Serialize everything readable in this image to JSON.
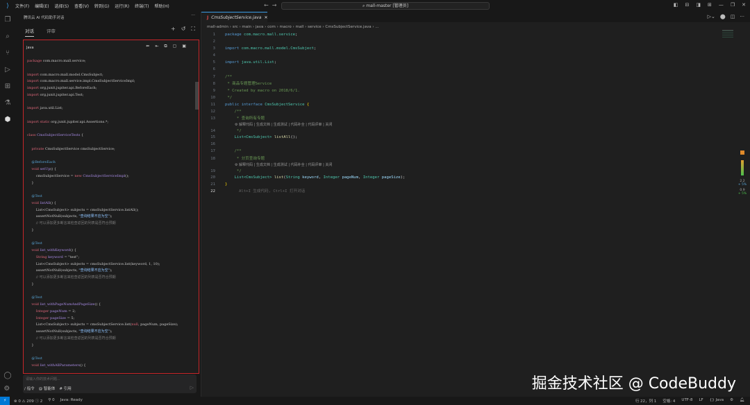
{
  "titlebar": {
    "menu": [
      "文件(F)",
      "编辑(E)",
      "选择(S)",
      "查看(V)",
      "转到(G)",
      "运行(R)",
      "终端(T)",
      "帮助(H)"
    ],
    "search": "mall-master [管理员]"
  },
  "sidebar": {
    "title": "腾讯云 AI 代码助手对话",
    "tabs": [
      "对话",
      "评审"
    ],
    "code_block": {
      "language": "Java",
      "lines": [
        [
          [
            "k",
            "package"
          ],
          [
            "p",
            " com.macro.mall.service;"
          ]
        ],
        [],
        [
          [
            "k",
            "import"
          ],
          [
            "p",
            " com.macro.mall.model.CmsSubject;"
          ]
        ],
        [
          [
            "k",
            "import"
          ],
          [
            "p",
            " com.macro.mall.service.impl.CmsSubjectServiceImpl;"
          ]
        ],
        [
          [
            "k",
            "import"
          ],
          [
            "p",
            " org.junit.jupiter.api.BeforeEach;"
          ]
        ],
        [
          [
            "k",
            "import"
          ],
          [
            "p",
            " org.junit.jupiter.api.Test;"
          ]
        ],
        [],
        [
          [
            "k",
            "import"
          ],
          [
            "p",
            " java.util.List;"
          ]
        ],
        [],
        [
          [
            "k",
            "import static"
          ],
          [
            "p",
            " org.junit.jupiter.api.Assertions.*;"
          ]
        ],
        [],
        [
          [
            "k",
            "class"
          ],
          [
            "ty",
            " CmsSubjectServiceTests"
          ],
          [
            "p",
            " {"
          ]
        ],
        [],
        [
          [
            "k",
            "    private"
          ],
          [
            "p",
            " CmsSubjectService cmsSubjectService;"
          ]
        ],
        [],
        [
          [
            "an",
            "    @BeforeEach"
          ]
        ],
        [
          [
            "k",
            "    void"
          ],
          [
            "ty",
            " setUp"
          ],
          [
            "p",
            "() {"
          ]
        ],
        [
          [
            "p",
            "        cmsSubjectService = "
          ],
          [
            "k",
            "new"
          ],
          [
            "ty",
            " CmsSubjectServiceImpl"
          ],
          [
            "p",
            "();"
          ]
        ],
        [
          [
            "p",
            "    }"
          ]
        ],
        [],
        [
          [
            "an",
            "    @Test"
          ]
        ],
        [
          [
            "k",
            "    void"
          ],
          [
            "ty",
            " listAll"
          ],
          [
            "p",
            "() {"
          ]
        ],
        [
          [
            "p",
            "        List<CmsSubject> subjects = cmsSubjectService.listAll();"
          ]
        ],
        [
          [
            "p",
            "        assertNotNull(subjects, "
          ],
          [
            "st",
            "\"查询结果不应为空\""
          ],
          [
            "p",
            ");"
          ]
        ],
        [
          [
            "cm",
            "        // 可以添加更多断言来检查返回的列表是否符合预期"
          ]
        ],
        [
          [
            "p",
            "    }"
          ]
        ],
        [],
        [
          [
            "an",
            "    @Test"
          ]
        ],
        [
          [
            "k",
            "    void"
          ],
          [
            "ty",
            " list_withKeyword"
          ],
          [
            "p",
            "() {"
          ]
        ],
        [
          [
            "k",
            "        String"
          ],
          [
            "ty",
            " keyword"
          ],
          [
            "p",
            " = \"test\";"
          ]
        ],
        [
          [
            "p",
            "        List<CmsSubject> subjects = cmsSubjectService.list(keyword, 1, 10);"
          ]
        ],
        [
          [
            "p",
            "        assertNotNull(subjects, "
          ],
          [
            "st",
            "\"查询结果不应为空\""
          ],
          [
            "p",
            ");"
          ]
        ],
        [
          [
            "cm",
            "        // 可以添加更多断言来检查返回的列表是否符合预期"
          ]
        ],
        [
          [
            "p",
            "    }"
          ]
        ],
        [],
        [
          [
            "an",
            "    @Test"
          ]
        ],
        [
          [
            "k",
            "    void"
          ],
          [
            "ty",
            " list_withPageNumAndPageSize"
          ],
          [
            "p",
            "() {"
          ]
        ],
        [
          [
            "k",
            "        Integer"
          ],
          [
            "ty",
            " pageNum"
          ],
          [
            "p",
            " = 2;"
          ]
        ],
        [
          [
            "k",
            "        Integer"
          ],
          [
            "ty",
            " pageSize"
          ],
          [
            "p",
            " = 5;"
          ]
        ],
        [
          [
            "p",
            "        List<CmsSubject> subjects = cmsSubjectService.list("
          ],
          [
            "k",
            "null"
          ],
          [
            "p",
            ", pageNum, pageSize);"
          ]
        ],
        [
          [
            "p",
            "        assertNotNull(subjects, "
          ],
          [
            "st",
            "\"查询结果不应为空\""
          ],
          [
            "p",
            ");"
          ]
        ],
        [
          [
            "cm",
            "        // 可以添加更多断言来检查返回的列表是否符合预期"
          ]
        ],
        [
          [
            "p",
            "    }"
          ]
        ],
        [],
        [
          [
            "an",
            "    @Test"
          ]
        ],
        [
          [
            "k",
            "    void"
          ],
          [
            "ty",
            " list_withAllParameters"
          ],
          [
            "p",
            "() {"
          ]
        ]
      ]
    },
    "input": {
      "placeholder": "请输入你的技术问题...",
      "options": [
        "/ 指令",
        "@ 智能体",
        "# 引用"
      ]
    }
  },
  "editor": {
    "tab": "CmsSubjectService.java",
    "breadcrumb": "mall-admin › src › main › java › com › macro › mall › service › CmsSubjectService.java › ...",
    "codelens": "⚙ 解释代码 | 生成文档 | 生成测试 | 代码补全 | 代码评审 | 关闭",
    "hint": "Alt+I 生成代码, Ctrl+I 打开对话",
    "lines": [
      {
        "n": "1",
        "t": [
          [
            "ekw",
            "package"
          ],
          [
            "epk",
            " com.macro.mall.service"
          ],
          [
            "ep",
            ";"
          ]
        ]
      },
      {
        "n": "2",
        "t": []
      },
      {
        "n": "3",
        "t": [
          [
            "ekw",
            "import"
          ],
          [
            "epk",
            " com.macro.mall.model.CmsSubject"
          ],
          [
            "ep",
            ";"
          ]
        ]
      },
      {
        "n": "4",
        "t": []
      },
      {
        "n": "5",
        "t": [
          [
            "ekw",
            "import"
          ],
          [
            "epk",
            " java.util.List"
          ],
          [
            "ep",
            ";"
          ]
        ]
      },
      {
        "n": "6",
        "t": []
      },
      {
        "n": "7",
        "t": [
          [
            "ecm",
            "/**"
          ]
        ]
      },
      {
        "n": "8",
        "t": [
          [
            "ecm",
            " * 商品专题管理Service"
          ]
        ]
      },
      {
        "n": "9",
        "t": [
          [
            "ecm",
            " * Created by macro on 2018/6/1."
          ]
        ]
      },
      {
        "n": "10",
        "t": [
          [
            "ecm",
            " */"
          ]
        ]
      },
      {
        "n": "11",
        "t": [
          [
            "ekw",
            "public interface"
          ],
          [
            "ety",
            " CmsSubjectService"
          ],
          [
            "ebr",
            " {"
          ]
        ]
      },
      {
        "n": "12",
        "t": [
          [
            "ecm",
            "    /**"
          ]
        ]
      },
      {
        "n": "13",
        "t": [
          [
            "ecm",
            "     * 查询所有专题"
          ]
        ]
      },
      {
        "n": "14",
        "t": [
          [
            "ecm",
            "     */"
          ]
        ],
        "lens": true
      },
      {
        "n": "15",
        "t": [
          [
            "ety",
            "    List<CmsSubject>"
          ],
          [
            "efn",
            " listAll"
          ],
          [
            "ep",
            "();"
          ]
        ]
      },
      {
        "n": "16",
        "t": []
      },
      {
        "n": "17",
        "t": [
          [
            "ecm",
            "    /**"
          ]
        ]
      },
      {
        "n": "18",
        "t": [
          [
            "ecm",
            "     * 分页查询专题"
          ]
        ]
      },
      {
        "n": "19",
        "t": [
          [
            "ecm",
            "     */"
          ]
        ],
        "lens": true
      },
      {
        "n": "20",
        "t": [
          [
            "ety",
            "    List<CmsSubject>"
          ],
          [
            "efn",
            " list"
          ],
          [
            "ep",
            "("
          ],
          [
            "ety",
            "String"
          ],
          [
            "epa",
            " keyword"
          ],
          [
            "ep",
            ", "
          ],
          [
            "ety",
            "Integer"
          ],
          [
            "epa",
            " pageNum"
          ],
          [
            "ep",
            ", "
          ],
          [
            "ety",
            "Integer"
          ],
          [
            "epa",
            " pageSize"
          ],
          [
            "ep",
            ");"
          ]
        ]
      },
      {
        "n": "21",
        "t": [
          [
            "ebr",
            "}"
          ]
        ]
      },
      {
        "n": "22",
        "t": [],
        "hint": true,
        "cur": true
      }
    ],
    "gauge": {
      "badge": "1",
      "v1": "2.2",
      "v1sub": "+ 5%",
      "v2": "0.9",
      "v2sub": "+ 5%"
    }
  },
  "statusbar": {
    "errors": "0",
    "warnings": "209",
    "info": "2",
    "ports": "0",
    "java": "Java: Ready",
    "position": "行 22，列 1",
    "spaces": "空格: 4",
    "encoding": "UTF-8",
    "eol": "LF",
    "language": "{} Java"
  },
  "watermark": "掘金技术社区 @ CodeBuddy"
}
